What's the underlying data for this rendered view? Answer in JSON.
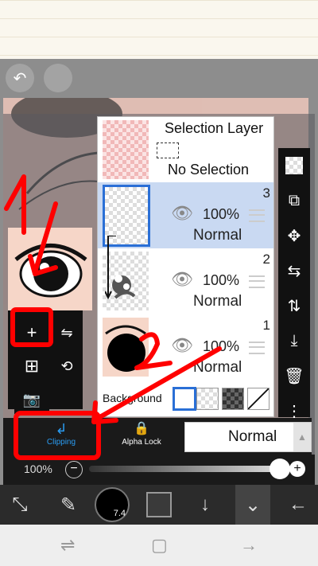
{
  "layers_panel": {
    "selection_layer": {
      "title": "Selection Layer",
      "status": "No Selection"
    },
    "layers": [
      {
        "number": "3",
        "opacity": "100%",
        "blend": "Normal",
        "selected": true
      },
      {
        "number": "2",
        "opacity": "100%",
        "blend": "Normal",
        "selected": false
      },
      {
        "number": "1",
        "opacity": "100%",
        "blend": "Normal",
        "selected": false
      }
    ],
    "background_label": "Background"
  },
  "mode_bar": {
    "clipping_label": "Clipping",
    "alpha_lock_label": "Alpha Lock",
    "blend_mode_value": "Normal"
  },
  "opacity_bar": {
    "value": "100%",
    "level": 1.0
  },
  "brush_size_value": "7.4",
  "annotations": {
    "mark1": "1",
    "mark2": "2"
  },
  "colors": {
    "accent": "#2a9df4",
    "selected_layer": "#c9d9f2",
    "annotation": "#ff0000"
  },
  "icons": {
    "top": [
      "undo-icon",
      "redo-icon"
    ],
    "right_tools": [
      "checker-icon",
      "layer-convert-icon",
      "move-icon",
      "flip-horizontal-icon",
      "flip-vertical-icon",
      "merge-down-icon",
      "trash-icon",
      "more-icon"
    ],
    "left_tools": [
      "add-layer-icon",
      "flip-icon",
      "add-copy-icon",
      "rotate-icon",
      "camera-icon"
    ],
    "bottom": [
      "transform-icon",
      "brush-icon",
      "brush-size-icon",
      "color-icon",
      "download-icon",
      "layers-icon",
      "back-icon"
    ],
    "nav": [
      "recent-apps-icon",
      "home-icon",
      "back-nav-icon"
    ]
  }
}
